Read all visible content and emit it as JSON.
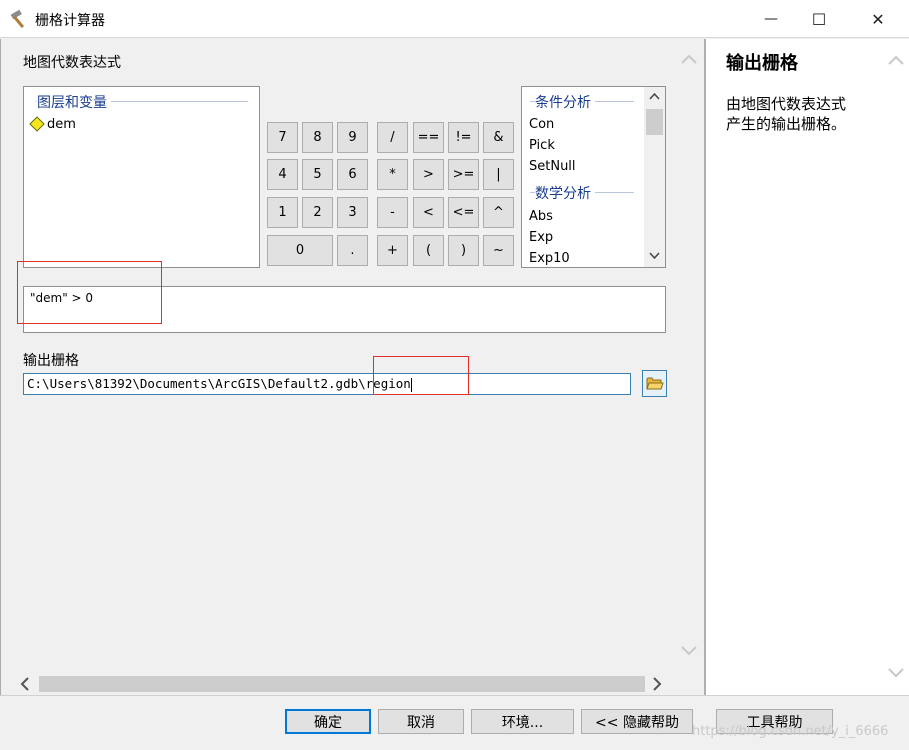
{
  "window": {
    "title": "栅格计算器",
    "minimize": "—",
    "maximize": "☐",
    "close": "✕"
  },
  "expression_label": "地图代数表达式",
  "layers": {
    "title": "图层和变量",
    "items": [
      "dem"
    ]
  },
  "calculator": {
    "rows": [
      [
        "7",
        "8",
        "9",
        "/",
        "==",
        "!=",
        "&"
      ],
      [
        "4",
        "5",
        "6",
        "*",
        ">",
        ">=",
        "|"
      ],
      [
        "1",
        "2",
        "3",
        "-",
        "<",
        "<=",
        "^"
      ],
      [
        "0",
        ".",
        "+",
        "(",
        ")",
        "~"
      ]
    ]
  },
  "functions": {
    "group1": "条件分析",
    "group1_items": [
      "Con",
      "Pick",
      "SetNull"
    ],
    "group2": "数学分析",
    "group2_items": [
      "Abs",
      "Exp",
      "Exp10"
    ]
  },
  "expression": "\"dem\" > 0",
  "output": {
    "label": "输出栅格",
    "value": "C:\\Users\\81392\\Documents\\ArcGIS\\Default2.gdb\\region"
  },
  "help": {
    "title": "输出栅格",
    "body": "由地图代数表达式\n产生的输出栅格。"
  },
  "buttons": {
    "ok": "确定",
    "cancel": "取消",
    "env": "环境...",
    "hide_help": "<< 隐藏帮助",
    "tool_help": "工具帮助"
  },
  "watermark": "https://blog.csdn.net/y_i_6666"
}
